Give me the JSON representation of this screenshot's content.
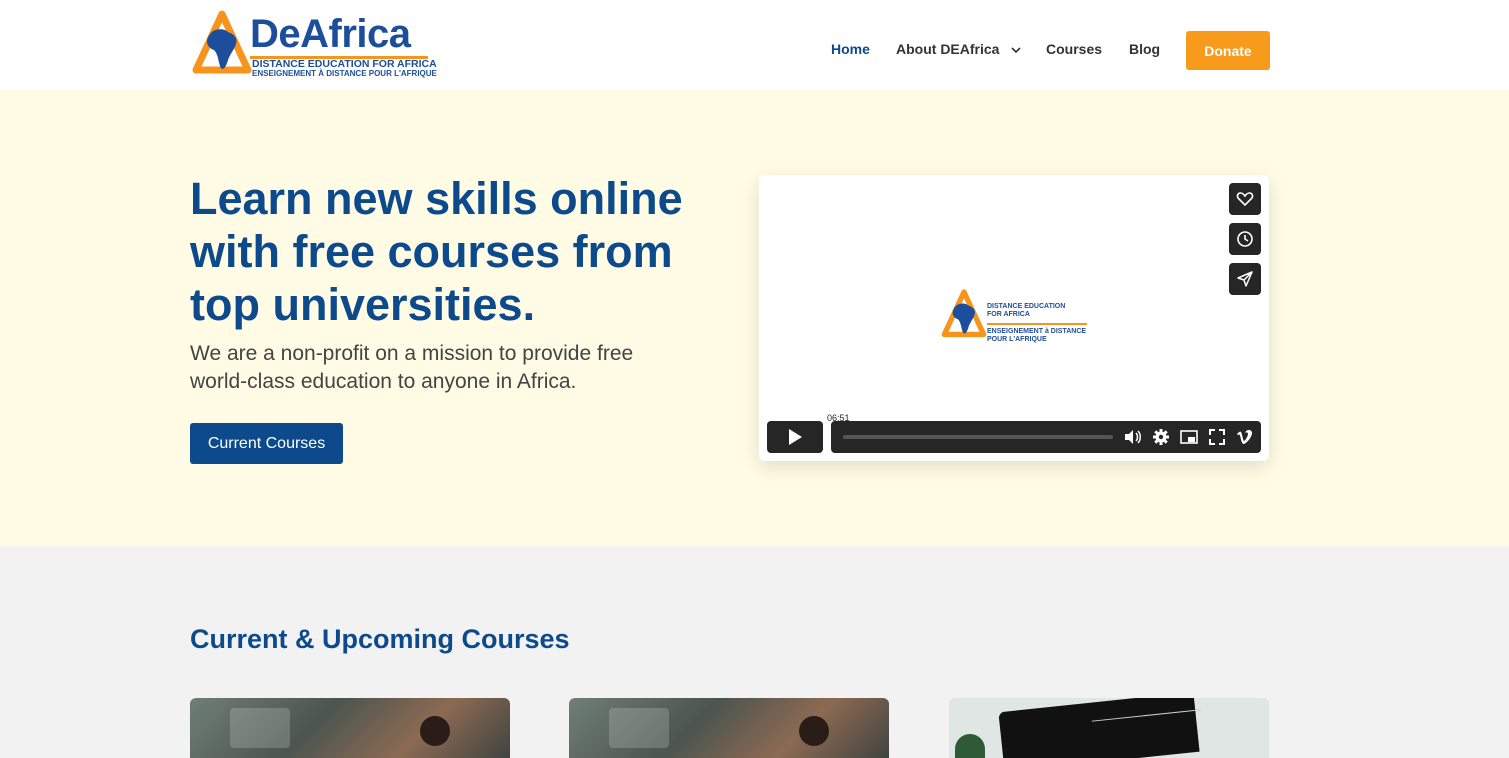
{
  "header": {
    "logo": {
      "word": "DeAfrica",
      "sub1": "DISTANCE EDUCATION FOR AFRICA",
      "sub2": "ENSEIGNEMENT À DISTANCE POUR L'AFRIQUE"
    },
    "nav": [
      {
        "label": "Home",
        "active": true
      },
      {
        "label": "About DEAfrica",
        "has_dropdown": true
      },
      {
        "label": "Courses"
      },
      {
        "label": "Blog"
      }
    ],
    "donate_label": "Donate"
  },
  "hero": {
    "title": "Learn new skills online with free courses from top universities.",
    "subtitle": "We are a non-profit on a mission to provide free world-class education to anyone in Africa.",
    "cta_label": "Current Courses",
    "video": {
      "logo_line1": "DISTANCE EDUCATION",
      "logo_line2": "FOR AFRICA",
      "logo_line3": "ENSEIGNEMENT à DISTANCE",
      "logo_line4": "POUR L'AFRIQUE",
      "time_tooltip": "06:51",
      "side_buttons": [
        "heart-icon",
        "clock-icon",
        "send-icon"
      ],
      "controls": [
        "volume-icon",
        "settings-icon",
        "pip-icon",
        "fullscreen-icon",
        "vimeo-icon"
      ],
      "progress": 0.0
    }
  },
  "courses": {
    "title": "Current & Upcoming Courses"
  },
  "colors": {
    "brand_blue": "#0c4a8c",
    "accent_orange": "#f89a1c",
    "hero_bg": "#fffbe5"
  }
}
